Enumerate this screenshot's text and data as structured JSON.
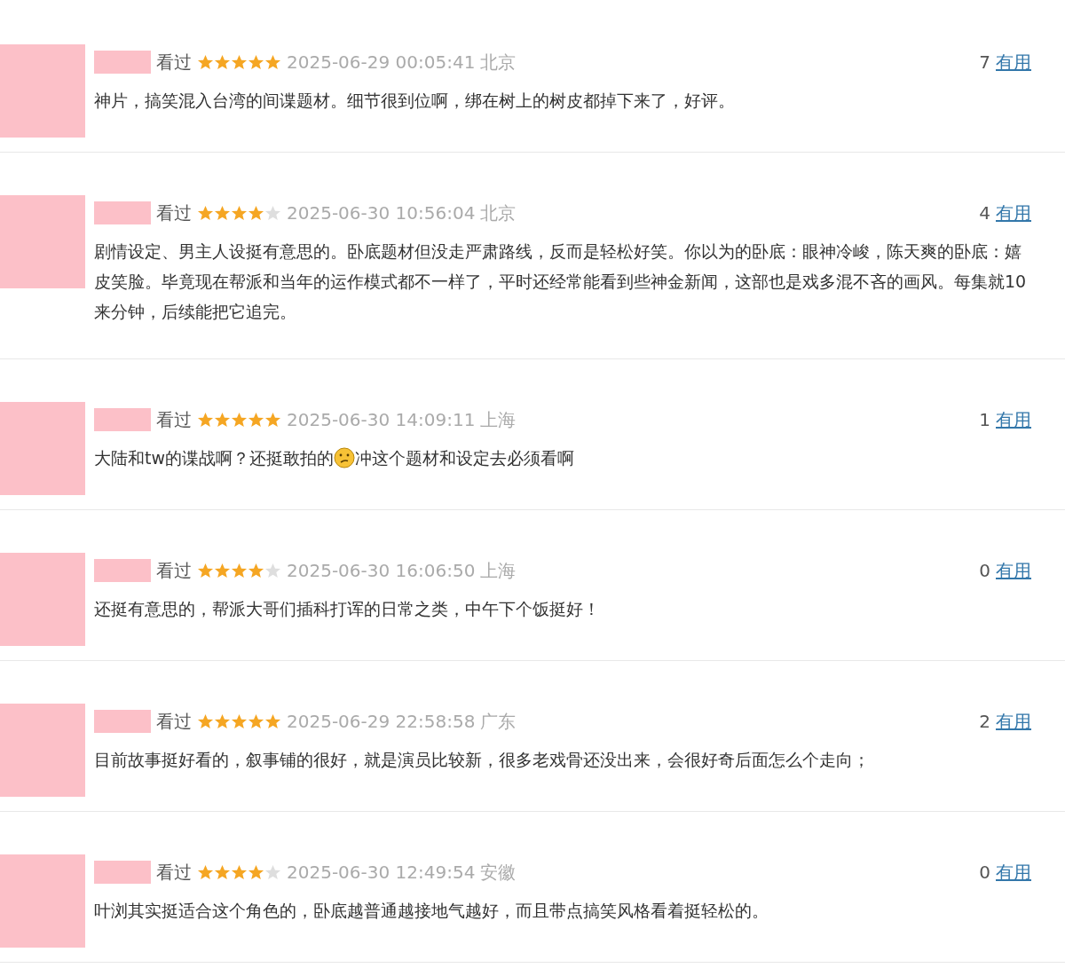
{
  "reviews": [
    {
      "status": "看过",
      "stars": 5,
      "time": "2025-06-29 00:05:41",
      "location": "北京",
      "votes": "7",
      "votes_label": "有用",
      "content": [
        {
          "kind": "text",
          "text": "神片，搞笑混入台湾的间谍题材。细节很到位啊，绑在树上的树皮都掉下来了，好评。"
        }
      ]
    },
    {
      "status": "看过",
      "stars": 4,
      "time": "2025-06-30 10:56:04",
      "location": "北京",
      "votes": "4",
      "votes_label": "有用",
      "content": [
        {
          "kind": "text",
          "text": "剧情设定、男主人设挺有意思的。卧底题材但没走严肃路线，反而是轻松好笑。你以为的卧底：眼神冷峻，陈天爽的卧底：嬉皮笑脸。毕竟现在帮派和当年的运作模式都不一样了，平时还经常能看到些神金新闻，这部也是戏多混不吝的画风。每集就10来分钟，后续能把它追完。"
        }
      ]
    },
    {
      "status": "看过",
      "stars": 5,
      "time": "2025-06-30 14:09:11",
      "location": "上海",
      "votes": "1",
      "votes_label": "有用",
      "content": [
        {
          "kind": "text",
          "text": "大陆和tw的谍战啊？还挺敢拍的"
        },
        {
          "kind": "emoji"
        },
        {
          "kind": "text",
          "text": "冲这个题材和设定去必须看啊"
        }
      ]
    },
    {
      "status": "看过",
      "stars": 4,
      "time": "2025-06-30 16:06:50",
      "location": "上海",
      "votes": "0",
      "votes_label": "有用",
      "content": [
        {
          "kind": "text",
          "text": "还挺有意思的，帮派大哥们插科打诨的日常之类，中午下个饭挺好！"
        }
      ]
    },
    {
      "status": "看过",
      "stars": 5,
      "time": "2025-06-29 22:58:58",
      "location": "广东",
      "votes": "2",
      "votes_label": "有用",
      "content": [
        {
          "kind": "text",
          "text": "目前故事挺好看的，叙事铺的很好，就是演员比较新，很多老戏骨还没出来，会很好奇后面怎么个走向；"
        }
      ]
    },
    {
      "status": "看过",
      "stars": 4,
      "time": "2025-06-30 12:49:54",
      "location": "安徽",
      "votes": "0",
      "votes_label": "有用",
      "content": [
        {
          "kind": "text",
          "text": "叶浏其实挺适合这个角色的，卧底越普通越接地气越好，而且带点搞笑风格看着挺轻松的。"
        }
      ]
    }
  ]
}
